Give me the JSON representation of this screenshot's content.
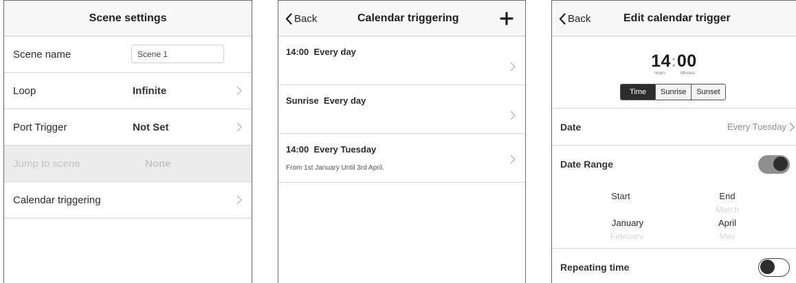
{
  "scene_settings": {
    "title": "Scene settings",
    "rows": [
      {
        "label": "Scene name",
        "value": ""
      },
      {
        "label": "Loop",
        "value": "Infinite"
      },
      {
        "label": "Port Trigger",
        "value": "Not Set"
      },
      {
        "label": "Jump to scene",
        "value": "None"
      },
      {
        "label": "Calendar triggering",
        "value": ""
      }
    ],
    "scene_name_input": "Scene 1"
  },
  "calendar_triggering": {
    "back": "Back",
    "title": "Calendar triggering",
    "triggers": [
      {
        "title": "14:00  Every day",
        "subtitle": ""
      },
      {
        "title": "Sunrise  Every day",
        "subtitle": ""
      },
      {
        "title": "14:00  Every Tuesday",
        "subtitle": "From 1st January Until 3rd April."
      }
    ]
  },
  "edit_trigger": {
    "back": "Back",
    "title": "Edit calendar trigger",
    "time": {
      "hours": "14",
      "sep": ":",
      "minutes": "00",
      "hours_label": "Hours",
      "minutes_label": "Minutes"
    },
    "modes": [
      "Time",
      "Sunrise",
      "Sunset"
    ],
    "selected_mode": "Time",
    "date_label": "Date",
    "date_value": "Every Tuesday",
    "date_range_label": "Date Range",
    "date_range_on": true,
    "start_label": "Start",
    "end_label": "End",
    "start_picker": {
      "above": "",
      "selected": "January",
      "below": "February"
    },
    "end_picker": {
      "above": "March",
      "selected": "April",
      "below": "May"
    },
    "repeating_label": "Repeating time",
    "repeating_on": false
  },
  "colors": {
    "accent": "#2d2d2d",
    "divider": "#d6d6d6",
    "disabled_bg": "#ececec"
  }
}
